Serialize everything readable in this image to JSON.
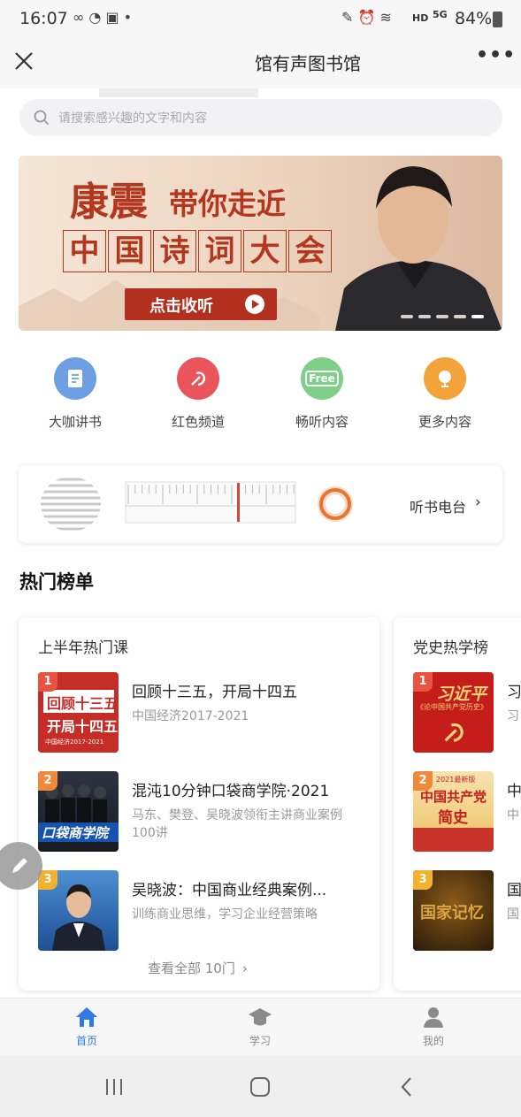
{
  "status": {
    "time": "16:07",
    "battery": "84%",
    "net": "HD",
    "signal": "5G"
  },
  "titlebar": {
    "title": "馆有声图书馆"
  },
  "search": {
    "placeholder": "请搜索感兴趣的文字和内容"
  },
  "banner": {
    "line1_a": "康震",
    "line1_b": "带你走近",
    "line2": [
      "中",
      "国",
      "诗",
      "词",
      "大",
      "会"
    ],
    "cta": "点击收听"
  },
  "categories": [
    {
      "label": "大咖讲书",
      "icon": "book-icon",
      "color": "#6f9fe3"
    },
    {
      "label": "红色频道",
      "icon": "party-emblem-icon",
      "color": "#e9555a"
    },
    {
      "label": "畅听内容",
      "icon": "free-icon",
      "color": "#7fcf89",
      "badge": "Free"
    },
    {
      "label": "更多内容",
      "icon": "globe-icon",
      "color": "#f2a33a"
    }
  ],
  "radio": {
    "label": "听书电台"
  },
  "hot": {
    "title": "热门榜单"
  },
  "card1": {
    "title": "上半年热门课",
    "items": [
      {
        "rank": "1",
        "title": "回顾十三五，开局十四五",
        "sub": "中国经济2017-2021",
        "thumb_text1": "回顾十三五",
        "thumb_text2": "开局十四五",
        "thumb_text3": "中国经济2017-2021"
      },
      {
        "rank": "2",
        "title": "混沌10分钟口袋商学院·2021",
        "sub": "马东、樊登、吴晓波领衔主讲商业案例100讲",
        "thumb_text1": "口袋商学院"
      },
      {
        "rank": "3",
        "title": "吴晓波：中国商业经典案例...",
        "sub": "训练商业思维，学习企业经营策略"
      }
    ],
    "more": "查看全部 10门"
  },
  "card2": {
    "title": "党史热学榜",
    "items": [
      {
        "rank": "1",
        "title": "习",
        "sub": "习",
        "thumb_text1": "习近平",
        "thumb_text2": "《论中国共产党历史》"
      },
      {
        "rank": "2",
        "title": "中",
        "sub": "中",
        "thumb_text1": "2021最新版",
        "thumb_text2": "中国共产党",
        "thumb_text3": "简史"
      },
      {
        "rank": "3",
        "title": "国",
        "sub": "国",
        "thumb_text1": "国家记忆"
      }
    ]
  },
  "nav": {
    "items": [
      {
        "label": "首页",
        "active": true
      },
      {
        "label": "学习"
      },
      {
        "label": "我的"
      }
    ]
  },
  "colors": {
    "accent": "#2f7be5",
    "rank1": "#e9533f",
    "rank2": "#f08a3a",
    "rank3": "#f2b230"
  }
}
